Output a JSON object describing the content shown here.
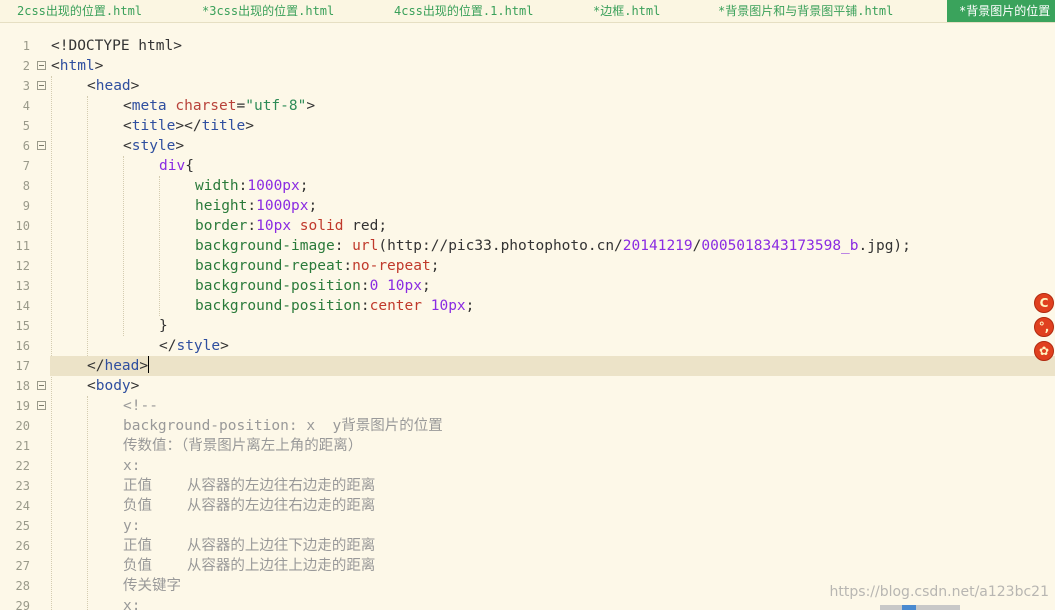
{
  "tabs": [
    {
      "label": "2css出现的位置.html"
    },
    {
      "label": "*3css出现的位置.html"
    },
    {
      "label": "4css出现的位置.1.html"
    },
    {
      "label": "*边框.html"
    },
    {
      "label": "*背景图片和与背景图平铺.html"
    },
    {
      "label": "*背景图片的位置"
    }
  ],
  "active_tab_index": 5,
  "current_line": 17,
  "lines": [
    {
      "n": "1"
    },
    {
      "n": "2"
    },
    {
      "n": "3"
    },
    {
      "n": "4"
    },
    {
      "n": "5"
    },
    {
      "n": "6"
    },
    {
      "n": "7"
    },
    {
      "n": "8"
    },
    {
      "n": "9"
    },
    {
      "n": "10"
    },
    {
      "n": "11"
    },
    {
      "n": "12"
    },
    {
      "n": "13"
    },
    {
      "n": "14"
    },
    {
      "n": "15"
    },
    {
      "n": "16"
    },
    {
      "n": "17"
    },
    {
      "n": "18"
    },
    {
      "n": "19"
    },
    {
      "n": "20"
    },
    {
      "n": "21"
    },
    {
      "n": "22"
    },
    {
      "n": "23"
    },
    {
      "n": "24"
    },
    {
      "n": "25"
    },
    {
      "n": "26"
    },
    {
      "n": "27"
    },
    {
      "n": "28"
    },
    {
      "n": "29"
    }
  ],
  "code": {
    "l1": "<!DOCTYPE html>",
    "l2": {
      "open": "<",
      "tag": "html",
      "close": ">"
    },
    "l3": {
      "open": "<",
      "tag": "head",
      "close": ">"
    },
    "l4": {
      "open": "<",
      "tag": "meta",
      "attr": "charset",
      "eq": "=",
      "val": "\"utf-8\"",
      "close": ">"
    },
    "l5": {
      "open": "<",
      "tag": "title",
      "mid": "></",
      "tag2": "title",
      "close": ">"
    },
    "l6": {
      "open": "<",
      "tag": "style",
      "close": ">"
    },
    "l7": {
      "sel": "div",
      "brace": "{"
    },
    "l8": {
      "prop": "width",
      "colon": ":",
      "val": "1000px",
      "semi": ";"
    },
    "l9": {
      "prop": "height",
      "colon": ":",
      "val": "1000px",
      "semi": ";"
    },
    "l10": {
      "prop": "border",
      "colon": ":",
      "val": "10px",
      "kw": " solid",
      "rest": " red;"
    },
    "l11": {
      "prop": "background-image",
      "colon": ": ",
      "kw": "url",
      "p1": "(http://pic33.photophoto.cn/",
      "n1": "20141219",
      "slash": "/",
      "n2": "0005018343173598_b",
      "p2": ".jpg);"
    },
    "l12": {
      "prop": "background-repeat",
      "colon": ":",
      "kw": "no-repeat",
      "semi": ";"
    },
    "l13": {
      "prop": "background-position",
      "colon": ":",
      "val": "0 10px",
      "semi": ";"
    },
    "l14": {
      "prop": "background-position",
      "colon": ":",
      "kw": "center",
      "val": " 10px",
      "semi": ";"
    },
    "l15": "}",
    "l16": {
      "open": "</",
      "tag": "style",
      "close": ">"
    },
    "l17": {
      "open": "</",
      "tag": "head",
      "close": ">"
    },
    "l18": {
      "open": "<",
      "tag": "body",
      "close": ">"
    },
    "l19": "<!--",
    "l20": "background-position: x  y背景图片的位置",
    "l21": "传数值：（背景图片离左上角的距离）",
    "l22": "x:",
    "l23": "正值    从容器的左边往右边走的距离",
    "l24": "负值    从容器的左边往右边走的距离",
    "l25": "y:",
    "l26": "正值    从容器的上边往下边走的距离",
    "l27": "负值    从容器的上边往上边走的距离",
    "l28": "传关键字",
    "l29": "x:"
  },
  "side_icons": [
    {
      "glyph": "C"
    },
    {
      "glyph": "°,"
    },
    {
      "glyph": "✿"
    }
  ],
  "watermark": "https://blog.csdn.net/a123bc21",
  "colors": {
    "background": "#fdf8e8",
    "tab_text": "#3aa05a",
    "active_tab_bg": "#3aa35c",
    "tag": "#2f4f9f",
    "attribute": "#b8423a",
    "string": "#2e8b57",
    "value": "#8a2be2",
    "comment": "#999999",
    "current_line": "#ece3c8"
  }
}
